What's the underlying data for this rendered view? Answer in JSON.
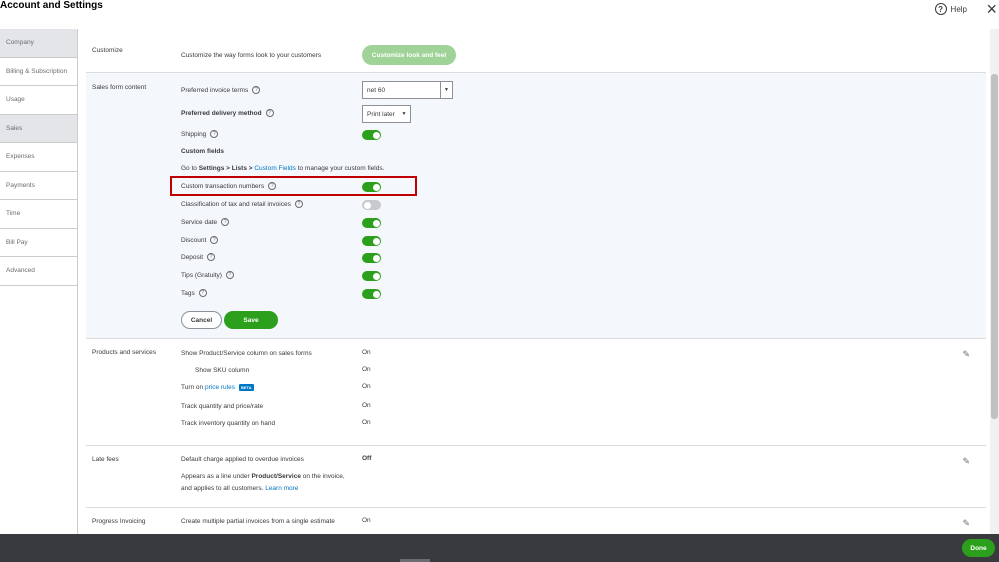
{
  "header": {
    "title": "Account and Settings",
    "help_label": "Help",
    "help_icon": "?",
    "close_icon": "×"
  },
  "sidebar": {
    "items": [
      {
        "label": "Company",
        "active": true
      },
      {
        "label": "Billing & Subscription",
        "active": false
      },
      {
        "label": "Usage",
        "active": false
      },
      {
        "label": "Sales",
        "active": true
      },
      {
        "label": "Expenses",
        "active": false
      },
      {
        "label": "Payments",
        "active": false
      },
      {
        "label": "Time",
        "active": false
      },
      {
        "label": "Bill Pay",
        "active": false
      },
      {
        "label": "Advanced",
        "active": false
      }
    ]
  },
  "customize": {
    "label": "Customize",
    "description": "Customize the way forms look to your customers",
    "button": "Customize look and feel"
  },
  "sales_form": {
    "label": "Sales form content",
    "preferred_terms_label": "Preferred invoice terms",
    "preferred_terms_value": "net 60",
    "delivery_label": "Preferred delivery method",
    "delivery_value": "Print later",
    "shipping_label": "Shipping",
    "custom_fields_heading": "Custom fields",
    "custom_fields_text_prefix": "Go to ",
    "custom_fields_text_path": "Settings > Lists > ",
    "custom_fields_link": "Custom Fields",
    "custom_fields_text_suffix": " to manage your custom fields.",
    "custom_txn_label": "Custom transaction numbers",
    "classification_label": "Classification of tax and retail invoices",
    "service_date_label": "Service date",
    "discount_label": "Discount",
    "deposit_label": "Deposit",
    "tips_label": "Tips (Gratuity)",
    "tags_label": "Tags",
    "cancel": "Cancel",
    "save": "Save"
  },
  "products": {
    "label": "Products and services",
    "rows": [
      {
        "label": "Show Product/Service column on sales forms",
        "value": "On"
      },
      {
        "label": "Show SKU column",
        "value": "On"
      },
      {
        "label": "Turn on ",
        "link": "price rules",
        "badge": "BETA",
        "value": "On"
      },
      {
        "label": "Track quantity and price/rate",
        "value": "On"
      },
      {
        "label": "Track inventory quantity on hand",
        "value": "On"
      }
    ]
  },
  "late_fees": {
    "label": "Late fees",
    "row_label": "Default charge applied to overdue invoices",
    "value": "Off",
    "desc_prefix": "Appears as a line under ",
    "desc_bold": "Product/Service",
    "desc_suffix": " on the invoice,",
    "desc_line2": "and applies to all customers. ",
    "learn_more": "Learn more"
  },
  "progress": {
    "label": "Progress Invoicing",
    "row_label": "Create multiple partial invoices from a single estimate",
    "value": "On"
  },
  "footer": {
    "done": "Done"
  },
  "colors": {
    "accent": "#2ca01c",
    "link": "#0077c5",
    "highlight": "#c00000"
  }
}
